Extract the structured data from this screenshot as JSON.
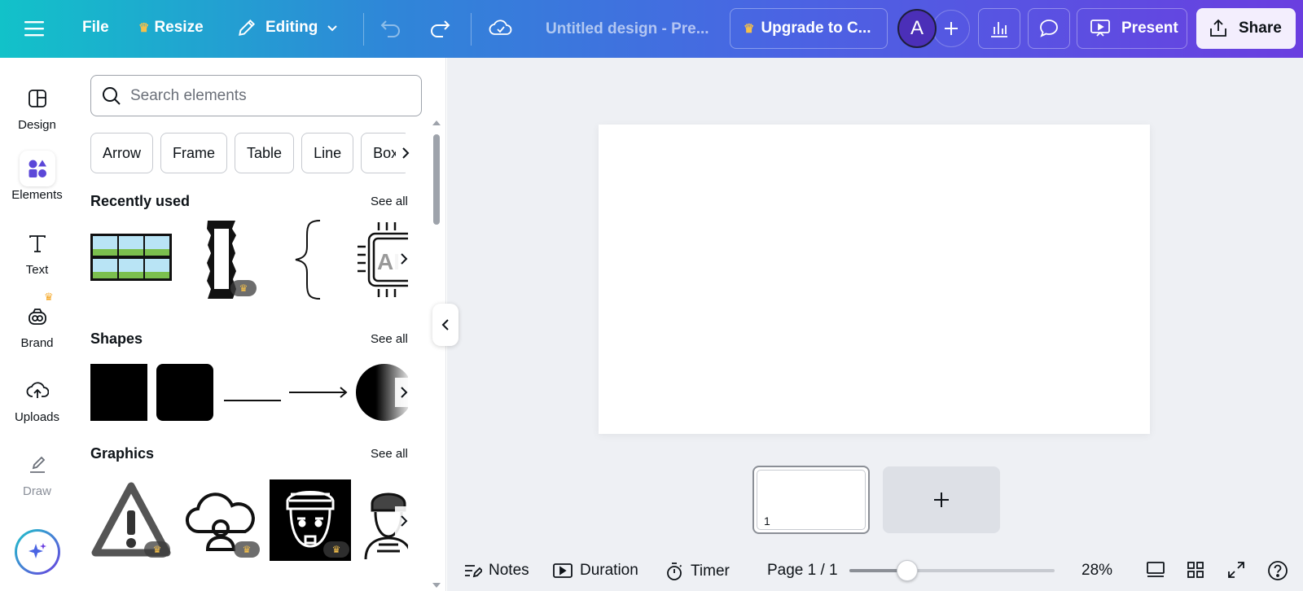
{
  "topbar": {
    "file_label": "File",
    "resize_label": "Resize",
    "editing_label": "Editing",
    "doc_title": "Untitled design - Pre...",
    "upgrade_label": "Upgrade to C...",
    "avatar_initial": "A",
    "present_label": "Present",
    "share_label": "Share",
    "crown_glyph": "♛"
  },
  "rail": {
    "items": [
      {
        "label": "Design"
      },
      {
        "label": "Elements"
      },
      {
        "label": "Text"
      },
      {
        "label": "Brand"
      },
      {
        "label": "Uploads"
      },
      {
        "label": "Draw"
      }
    ]
  },
  "panel": {
    "search_placeholder": "Search elements",
    "chips": [
      "Arrow",
      "Frame",
      "Table",
      "Line",
      "Box"
    ],
    "sections": {
      "recent": {
        "title": "Recently used",
        "see_all": "See all"
      },
      "shapes": {
        "title": "Shapes",
        "see_all": "See all"
      },
      "graphics": {
        "title": "Graphics",
        "see_all": "See all"
      }
    },
    "pro_badge": "♛"
  },
  "canvas": {
    "thumb_number": "1"
  },
  "bottombar": {
    "notes_label": "Notes",
    "duration_label": "Duration",
    "timer_label": "Timer",
    "page_indicator": "Page 1 / 1",
    "zoom_label": "28%",
    "zoom_fraction": 0.28
  },
  "colors": {
    "brand_gradient_start": "#12c2c9",
    "brand_gradient_end": "#6a3ee0",
    "accent_purple": "#4b2fb8",
    "crown_gold": "#f5a623"
  }
}
